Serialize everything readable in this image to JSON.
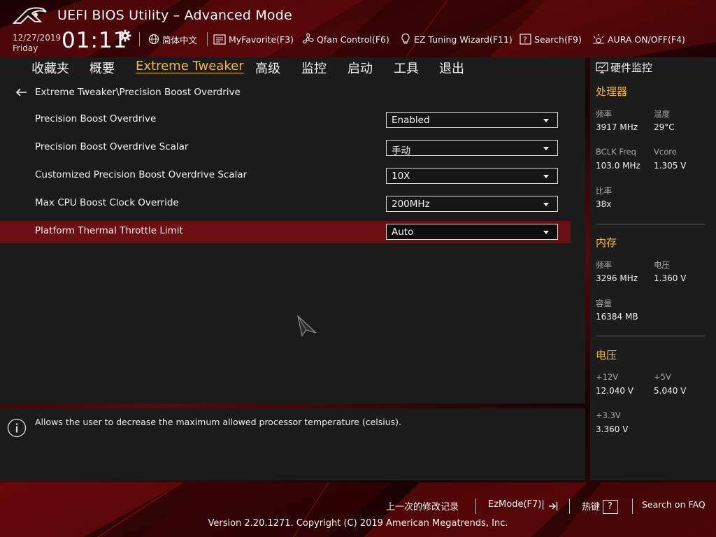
{
  "header": {
    "title": "UEFI BIOS Utility – Advanced Mode",
    "date": "12/27/2019",
    "day": "Friday",
    "time": "01:11",
    "items": [
      {
        "label": "简体中文",
        "icon": "globe-icon"
      },
      {
        "label": "MyFavorite(F3)",
        "icon": "favorite-list-icon"
      },
      {
        "label": "Qfan Control(F6)",
        "icon": "fan-icon"
      },
      {
        "label": "EZ Tuning Wizard(F11)",
        "icon": "lightbulb-icon"
      },
      {
        "label": "Search(F9)",
        "icon": "search-help-icon"
      },
      {
        "label": "AURA ON/OFF(F4)",
        "icon": "aura-light-icon"
      }
    ]
  },
  "nav": {
    "tabs": [
      {
        "label": "收藏夹"
      },
      {
        "label": "概要"
      },
      {
        "label": "Extreme Tweaker",
        "active": true
      },
      {
        "label": "高级"
      },
      {
        "label": "监控"
      },
      {
        "label": "启动"
      },
      {
        "label": "工具"
      },
      {
        "label": "退出"
      }
    ]
  },
  "breadcrumb": "Extreme Tweaker\\Precision Boost Overdrive",
  "settings": [
    {
      "label": "Precision Boost Overdrive",
      "value": "Enabled"
    },
    {
      "label": "Precision Boost Overdrive Scalar",
      "value": "手动"
    },
    {
      "label": "Customized Precision Boost Overdrive Scalar",
      "value": "10X"
    },
    {
      "label": "Max CPU Boost Clock Override",
      "value": "200MHz"
    },
    {
      "label": "Platform Thermal Throttle Limit",
      "value": "Auto",
      "selected": true
    }
  ],
  "help": {
    "text": "Allows the user to decrease the maximum allowed processor temperature (celsius)."
  },
  "monitor": {
    "title": "硬件监控",
    "cpu": {
      "section": "处理器",
      "freq_label": "频率",
      "freq": "3917 MHz",
      "temp_label": "温度",
      "temp": "29°C",
      "bclk_label": "BCLK Freq",
      "bclk": "103.0 MHz",
      "vcore_label": "Vcore",
      "vcore": "1.305 V",
      "ratio_label": "比率",
      "ratio": "38x"
    },
    "memory": {
      "section": "内存",
      "freq_label": "频率",
      "freq": "3296 MHz",
      "volt_label": "电压",
      "volt": "1.360 V",
      "cap_label": "容量",
      "cap": "16384 MB"
    },
    "voltage": {
      "section": "电压",
      "v12_label": "+12V",
      "v12": "12.040 V",
      "v5_label": "+5V",
      "v5": "5.040 V",
      "v33_label": "+3.3V",
      "v33": "3.360 V"
    }
  },
  "footer": {
    "last_modified": "上一次的修改记录",
    "ezmode": "EzMode(F7)|",
    "hotkeys": "热键",
    "hotkeys_q": "?",
    "search_faq": "Search on FAQ",
    "copyright": "Version 2.20.1271. Copyright (C) 2019 American Megatrends, Inc."
  },
  "colors": {
    "accent": "#f3b73a",
    "selected_row": "#6a0f12",
    "panel": "#1b1b1b"
  }
}
